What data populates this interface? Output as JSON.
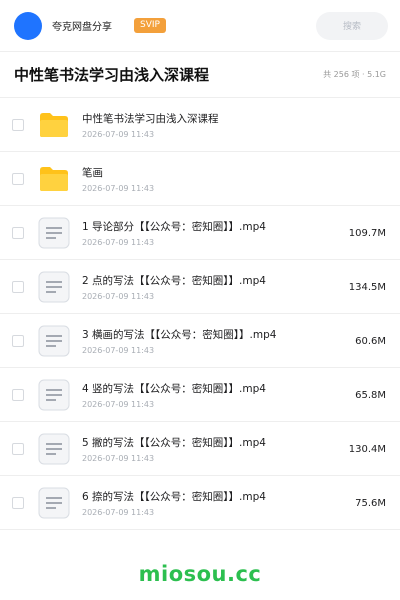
{
  "header": {
    "user_name": "夸克网盘分享",
    "badge": "SVIP",
    "search_placeholder": "搜索",
    "accent_color": "#1f74ff",
    "badge_color": "#f3a03b"
  },
  "folder": {
    "title": "中性笔书法学习由浅入深课程",
    "meta": "共 256 项 · 5.1G"
  },
  "items": [
    {
      "type": "folder",
      "icon": "folder-icon",
      "name": "中性笔书法学习由浅入深课程",
      "date": "2026-07-09 11:43",
      "size": ""
    },
    {
      "type": "folder",
      "icon": "folder-icon",
      "name": "笔画",
      "date": "2026-07-09 11:43",
      "size": ""
    },
    {
      "type": "file",
      "icon": "video-file-icon",
      "name": "1 导论部分【【公众号：密知圈】】.mp4",
      "date": "2026-07-09 11:43",
      "size": "109.7M"
    },
    {
      "type": "file",
      "icon": "video-file-icon",
      "name": "2 点的写法【【公众号：密知圈】】.mp4",
      "date": "2026-07-09 11:43",
      "size": "134.5M"
    },
    {
      "type": "file",
      "icon": "video-file-icon",
      "name": "3 横画的写法【【公众号：密知圈】】.mp4",
      "date": "2026-07-09 11:43",
      "size": "60.6M"
    },
    {
      "type": "file",
      "icon": "video-file-icon",
      "name": "4 竖的写法【【公众号：密知圈】】.mp4",
      "date": "2026-07-09 11:43",
      "size": "65.8M"
    },
    {
      "type": "file",
      "icon": "video-file-icon",
      "name": "5 撇的写法【【公众号：密知圈】】.mp4",
      "date": "2026-07-09 11:43",
      "size": "130.4M"
    },
    {
      "type": "file",
      "icon": "video-file-icon",
      "name": "6 捺的写法【【公众号：密知圈】】.mp4",
      "date": "2026-07-09 11:43",
      "size": "75.6M"
    }
  ],
  "watermark": "miosou.cc"
}
